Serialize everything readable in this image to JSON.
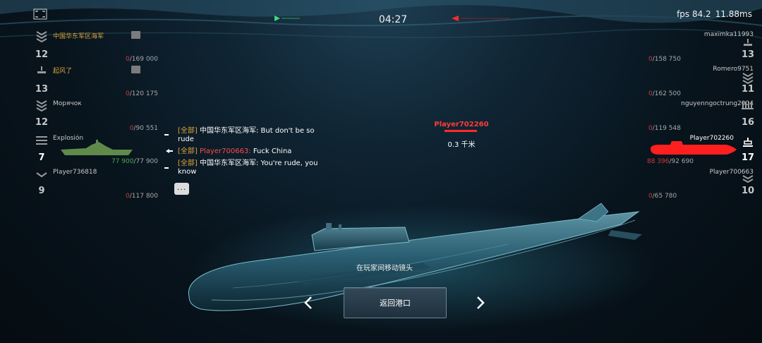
{
  "hud": {
    "timer": "04:27",
    "fps": "fps 84.2",
    "ping": "11.88ms"
  },
  "left_team": [
    {
      "name": "中国华东军区海军",
      "level": "12",
      "hp_current": "0",
      "hp_max": "/169 000",
      "rank_icon": "rank-chevrons-icon",
      "has_clan_box": true
    },
    {
      "name": "起风了",
      "level": "13",
      "hp_current": "0",
      "hp_max": "/120 175",
      "rank_icon": "rank-bar-icon",
      "has_clan_box": true
    },
    {
      "name": "Морячок",
      "level": "12",
      "hp_current": "0",
      "hp_max": "/90 551",
      "rank_icon": "rank-chevrons-icon",
      "has_clan_box": false
    },
    {
      "name": "Explosión",
      "level": "7",
      "hp_current": "77 900",
      "hp_max": "/77 900",
      "rank_icon": "rank-bars-icon",
      "has_clan_box": false
    },
    {
      "name": "Player736818",
      "level": "9",
      "hp_current": "0",
      "hp_max": "/117 800",
      "rank_icon": "rank-chevron-icon",
      "has_clan_box": false
    }
  ],
  "right_team": [
    {
      "name": "maximka11993",
      "level": "13",
      "hp_current": "0",
      "hp_max": "/158 750",
      "rank_icon": "rank-bar-icon"
    },
    {
      "name": "Romero9751",
      "level": "11",
      "hp_current": "0",
      "hp_max": "/162 500",
      "rank_icon": "rank-chevrons-icon"
    },
    {
      "name": "nguyenngoctrung2004",
      "level": "16",
      "hp_current": "0",
      "hp_max": "/119 548",
      "rank_icon": "rank-stars-icon"
    },
    {
      "name": "Player702260",
      "level": "17",
      "hp_current": "88 396",
      "hp_max": "/92 690",
      "rank_icon": "rank-bar-icon"
    },
    {
      "name": "Player700663",
      "level": "10",
      "hp_current": "0",
      "hp_max": "/65 780",
      "rank_icon": "rank-chevrons-icon"
    }
  ],
  "chat": [
    {
      "tag": "[全部]",
      "sender": "中国华东军区海军:",
      "message": " But don't be so rude"
    },
    {
      "tag": "[全部]",
      "sender": "Player700663:",
      "message": " Fuck China"
    },
    {
      "tag": "[全部]",
      "sender": "中国华东军区海军:",
      "message": " You're rude, you know"
    }
  ],
  "target": {
    "name": "Player702260",
    "distance": "0.3 千米"
  },
  "spectate_hint": "在玩家间移动镜头",
  "return_button": "返回港口",
  "colors": {
    "enemy": "#ff3b3b",
    "ally": "#4aa84a",
    "chat_tag": "#e0a43a",
    "highlight_name": "#d6a23b"
  }
}
